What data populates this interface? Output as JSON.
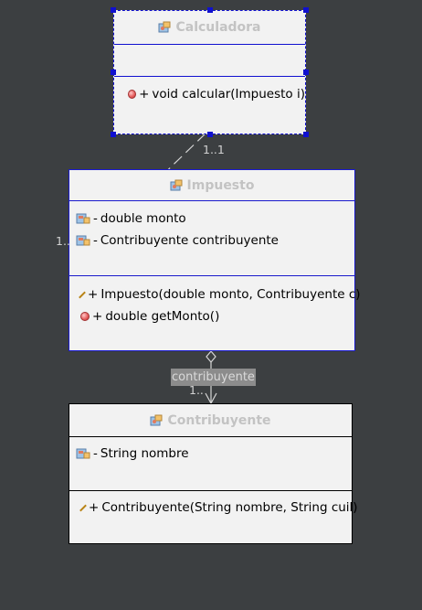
{
  "classes": {
    "calculadora": {
      "name": "Calculadora",
      "operations": [
        {
          "visibility": "+",
          "signature": "void calcular(Impuesto i)"
        }
      ]
    },
    "impuesto": {
      "name": "Impuesto",
      "attributes": [
        {
          "visibility": "-",
          "signature": "double monto"
        },
        {
          "visibility": "-",
          "signature": "Contribuyente contribuyente"
        }
      ],
      "operations": [
        {
          "visibility": "+",
          "signature": "Impuesto(double monto, Contribuyente c)",
          "kind": "constructor"
        },
        {
          "visibility": "+",
          "signature": "double getMonto()",
          "kind": "method"
        }
      ]
    },
    "contribuyente": {
      "name": "Contribuyente",
      "attributes": [
        {
          "visibility": "-",
          "signature": "String nombre"
        }
      ],
      "operations": [
        {
          "visibility": "+",
          "signature": "Contribuyente(String nombre, String cuil)",
          "kind": "constructor"
        }
      ]
    }
  },
  "associations": {
    "calc_impuesto": {
      "multiplicity_source": "1..1",
      "multiplicity_target": "1.."
    },
    "impuesto_contribuyente": {
      "role": "contribuyente",
      "multiplicity": "1.."
    }
  },
  "colors": {
    "background": "#3c3f41",
    "class_fill": "#f2f2f2",
    "selected_border": "#1010d0",
    "header_text": "#c3c3c3"
  }
}
